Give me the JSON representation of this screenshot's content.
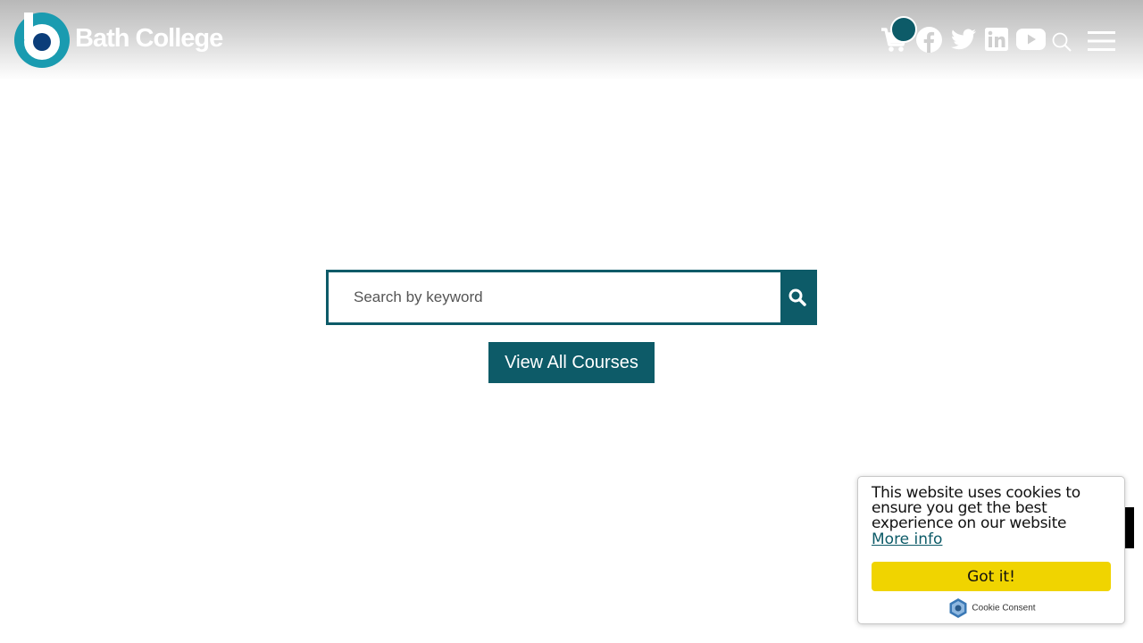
{
  "header": {
    "logo_text": "Bath College",
    "icons": [
      "cart-icon",
      "facebook-icon",
      "twitter-icon",
      "linkedin-icon",
      "youtube-icon",
      "search-icon",
      "menu-icon"
    ]
  },
  "search": {
    "placeholder": "Search by keyword",
    "value": ""
  },
  "courses_button": "View All Courses",
  "cookie": {
    "message": "This website uses cookies to ensure you get the best experience on our website",
    "more_info": "More info",
    "accept": "Got it!",
    "brand": "Cookie Consent"
  },
  "colors": {
    "brand": "#0d5b68",
    "accept": "#f0d400",
    "logo_ring": "#1a9bb0",
    "logo_center": "#0b3d7a"
  }
}
